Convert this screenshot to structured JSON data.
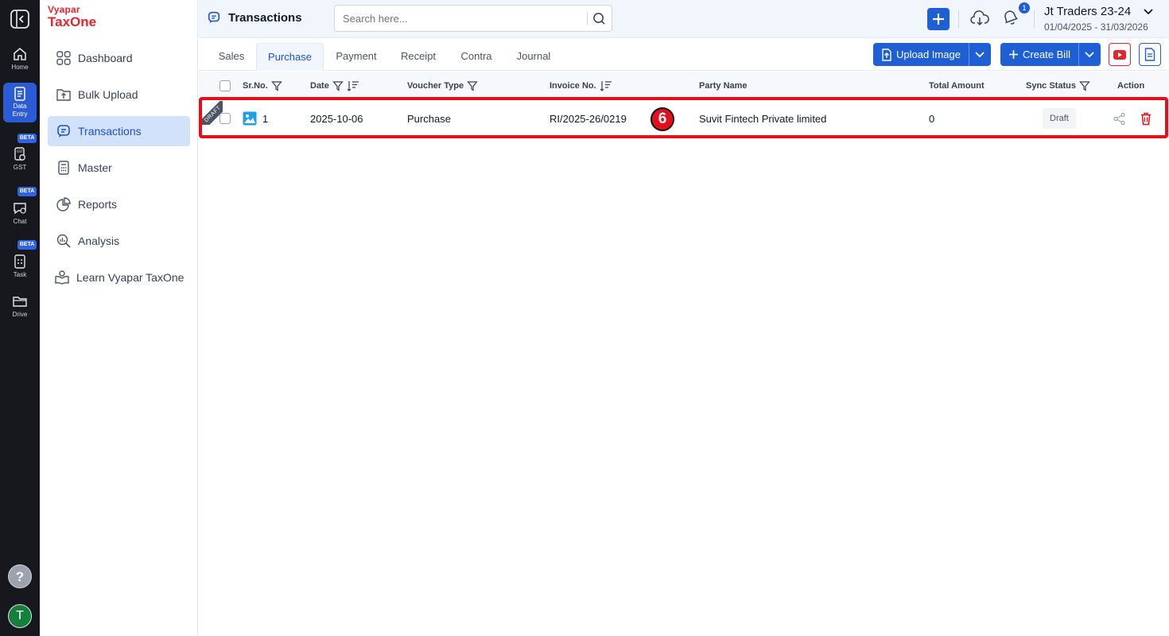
{
  "rail": {
    "items": [
      {
        "label": "Home",
        "icon": "home-icon"
      },
      {
        "label": "Data Entry",
        "icon": "data-entry-icon"
      },
      {
        "label": "GST",
        "icon": "gst-icon",
        "badge": "BETA"
      },
      {
        "label": "Chat",
        "icon": "chat-icon",
        "badge": "BETA"
      },
      {
        "label": "Task",
        "icon": "task-icon",
        "badge": "BETA"
      },
      {
        "label": "Drive",
        "icon": "folder-icon"
      }
    ],
    "help": "?",
    "avatar": "T"
  },
  "brand": {
    "line1": "Vyapar",
    "line2": "TaxOne"
  },
  "sidenav": {
    "items": [
      {
        "label": "Dashboard",
        "icon": "grid-icon"
      },
      {
        "label": "Bulk Upload",
        "icon": "upload-folder-icon"
      },
      {
        "label": "Transactions",
        "icon": "transactions-icon",
        "active": true
      },
      {
        "label": "Master",
        "icon": "calculator-icon"
      },
      {
        "label": "Reports",
        "icon": "pie-chart-icon"
      },
      {
        "label": "Analysis",
        "icon": "analysis-search-icon"
      },
      {
        "label": "Learn Vyapar TaxOne",
        "icon": "learn-icon"
      }
    ]
  },
  "header": {
    "title": "Transactions",
    "search_placeholder": "Search here...",
    "notification_count": "1",
    "company": "Jt Traders 23-24",
    "period": "01/04/2025 - 31/03/2026"
  },
  "tabs": [
    {
      "label": "Sales"
    },
    {
      "label": "Purchase",
      "active": true
    },
    {
      "label": "Payment"
    },
    {
      "label": "Receipt"
    },
    {
      "label": "Contra"
    },
    {
      "label": "Journal"
    }
  ],
  "toolbar": {
    "upload_label": "Upload Image",
    "create_label": "Create Bill"
  },
  "table": {
    "columns": [
      "Sr.No.",
      "Date",
      "Voucher Type",
      "Invoice No.",
      "Party Name",
      "Total Amount",
      "Sync Status",
      "Action"
    ],
    "rows": [
      {
        "ribbon": "DRAFT",
        "sr_no": "1",
        "date": "2025-10-06",
        "voucher_type": "Purchase",
        "invoice_no": "RI/2025-26/0219",
        "party_name": "Suvit Fintech Private limited",
        "total_amount": "0",
        "sync_status": "Draft"
      }
    ]
  },
  "annotation": {
    "step": "6"
  },
  "colors": {
    "brand_red": "#e3262e",
    "primary_blue": "#1f5fd6",
    "highlight_red": "#e3101b",
    "rail_bg": "#16181d",
    "active_nav_bg": "#d3e2fb"
  }
}
